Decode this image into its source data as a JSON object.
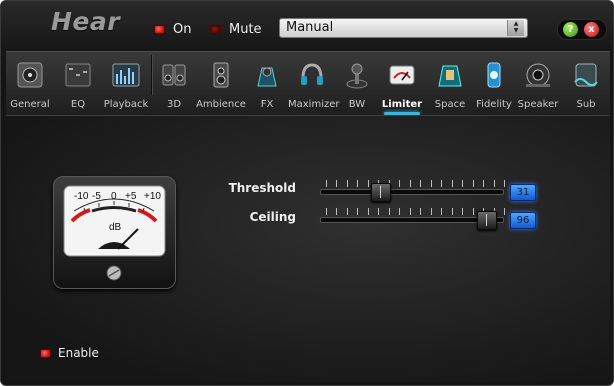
{
  "app": {
    "title": "Hear"
  },
  "header": {
    "on_label": "On",
    "mute_label": "Mute",
    "preset_value": "Manual",
    "help_label": "?",
    "close_label": "x"
  },
  "tabs": [
    {
      "label": "General",
      "icon": "speaker-box-icon"
    },
    {
      "label": "EQ",
      "icon": "equalizer-sliders-icon"
    },
    {
      "label": "Playback",
      "icon": "spectrum-icon"
    },
    {
      "label": "3D",
      "icon": "speakers-3d-icon"
    },
    {
      "label": "Ambience",
      "icon": "ambience-speaker-icon"
    },
    {
      "label": "FX",
      "icon": "fx-stage-icon"
    },
    {
      "label": "Maximizer",
      "icon": "headphones-icon"
    },
    {
      "label": "BW",
      "icon": "bw-joystick-icon"
    },
    {
      "label": "Limiter",
      "icon": "limiter-gauge-icon"
    },
    {
      "label": "Space",
      "icon": "space-room-icon"
    },
    {
      "label": "Fidelity",
      "icon": "fidelity-lamp-icon"
    },
    {
      "label": "Speaker",
      "icon": "speaker-driver-icon"
    },
    {
      "label": "Sub",
      "icon": "subwoofer-wave-icon"
    }
  ],
  "active_tab": "Limiter",
  "limiter": {
    "meter": {
      "scale": [
        "-10",
        "-5",
        "0",
        "+5",
        "+10"
      ],
      "unit": "dB"
    },
    "threshold": {
      "label": "Threshold",
      "value": "31",
      "level": 0.31
    },
    "ceiling": {
      "label": "Ceiling",
      "value": "96",
      "level": 0.96
    },
    "enable_label": "Enable"
  },
  "colors": {
    "accent": "#3fb4d8",
    "led_on": "#e01818",
    "readout": "#2f86ff"
  }
}
